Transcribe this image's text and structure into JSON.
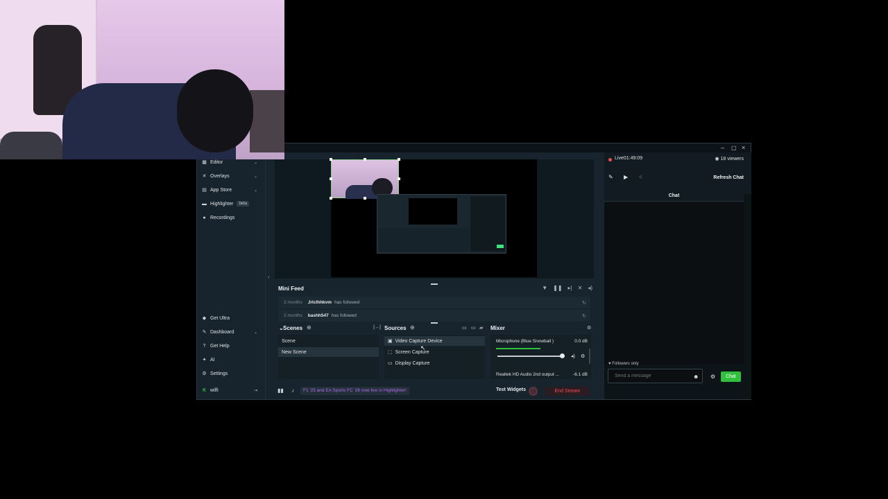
{
  "sidebar": {
    "items": [
      {
        "label": "Editor",
        "icon": "editor-icon"
      },
      {
        "label": "Overlays",
        "icon": "overlays-icon"
      },
      {
        "label": "App Store",
        "icon": "store-icon"
      },
      {
        "label": "Highlighter",
        "badge": "beta",
        "icon": "highlighter-icon"
      },
      {
        "label": "Recordings",
        "icon": "recordings-icon"
      }
    ],
    "bottom_items": [
      {
        "label": "Get Ultra",
        "icon": "ultra-icon"
      },
      {
        "label": "Dashboard",
        "icon": "dashboard-icon"
      },
      {
        "label": "Get Help",
        "icon": "help-icon"
      },
      {
        "label": "AI",
        "icon": "ai-icon"
      },
      {
        "label": "Settings",
        "icon": "gear-icon"
      }
    ],
    "user": "wilfi"
  },
  "minifeed": {
    "title": "Mini Feed",
    "rows": [
      {
        "time": "2 months",
        "user": "Jrlclhhkvm",
        "action": "has followed"
      },
      {
        "time": "2 months",
        "user": "bashh547",
        "action": "has followed"
      }
    ]
  },
  "scenes": {
    "title": "Scenes",
    "items": [
      "Scene",
      "New Scene"
    ],
    "selected": "New Scene"
  },
  "sources": {
    "title": "Sources",
    "items": [
      "Video Capture Device",
      "Screen Capture",
      "Display Capture"
    ]
  },
  "mixer": {
    "title": "Mixer",
    "channels": [
      {
        "name": "Microphone (Blue Snowball )",
        "db": "0.0 dB"
      },
      {
        "name": "Realtek HD Audio 2nd output ...",
        "db": "-6.1 dB"
      }
    ]
  },
  "footer": {
    "news": "F1 '25 and EA Sports FC '26 now live in Highlighter!",
    "test_widgets": "Test Widgets",
    "end_stream": "End Stream"
  },
  "chat": {
    "live_label": "Live",
    "live_time": "01:49:09",
    "viewers": "18 viewers",
    "refresh": "Refresh Chat",
    "tab": "Chat",
    "followers_only": "Followers only",
    "input_placeholder": "Send a message",
    "send_label": "Chat"
  },
  "colors": {
    "accent_green": "#31c03d",
    "live_red": "#ef4c5c",
    "highlight_purple": "#b36df0",
    "window_bg": "#17242d"
  }
}
